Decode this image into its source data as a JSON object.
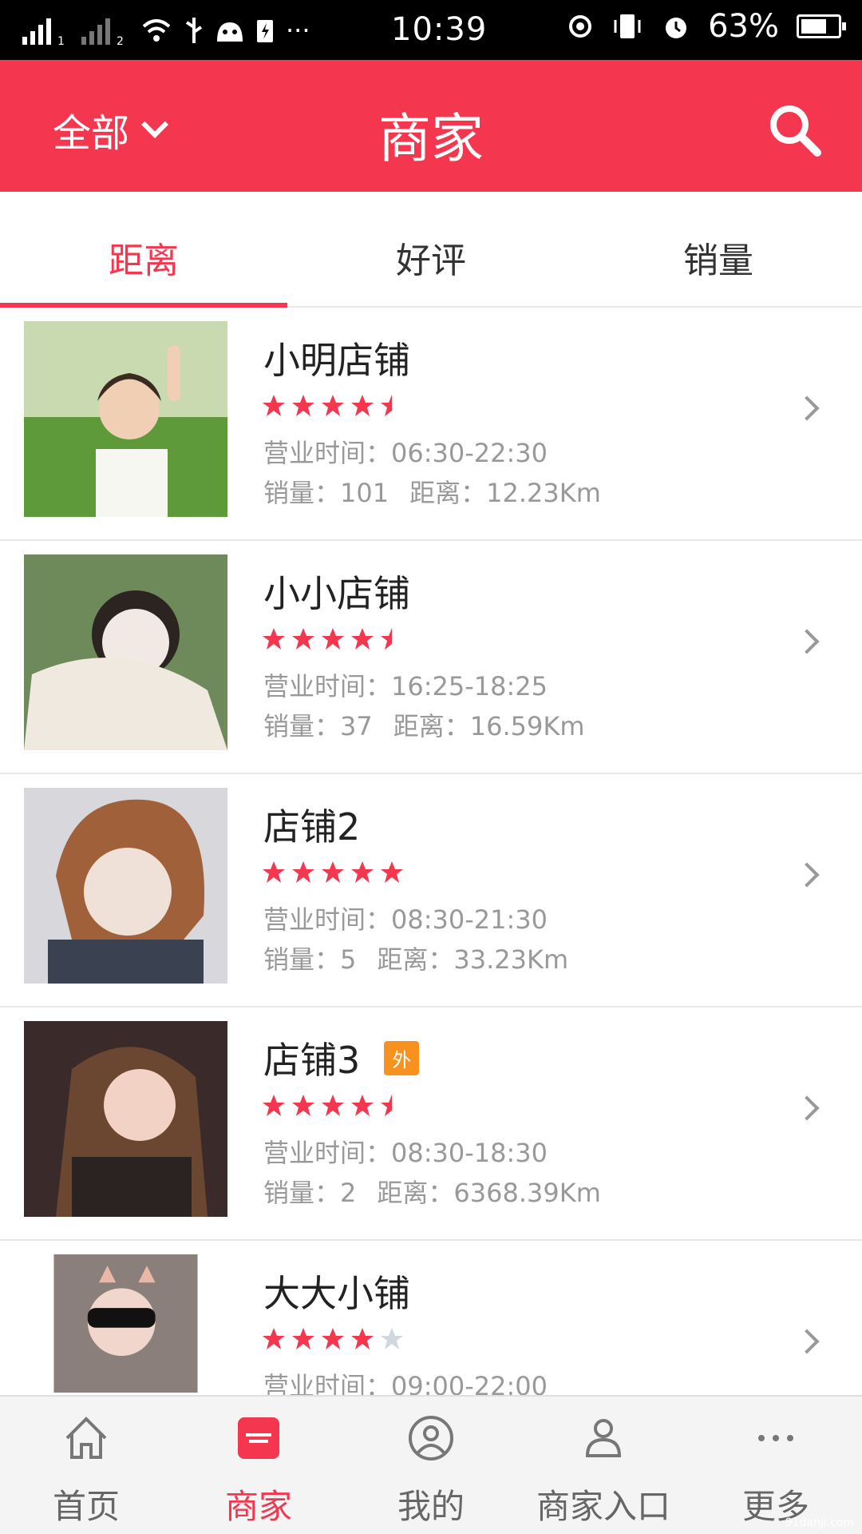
{
  "status_bar": {
    "time": "10:39",
    "battery": "63%",
    "sim1": "1",
    "sim2": "2",
    "more": "···"
  },
  "header": {
    "filter_label": "全部",
    "title": "商家",
    "search_icon": "search-icon",
    "background": "#f5364f"
  },
  "tabs": [
    {
      "label": "距离",
      "active": true
    },
    {
      "label": "好评",
      "active": false
    },
    {
      "label": "销量",
      "active": false
    }
  ],
  "stores": [
    {
      "name": "小明店铺",
      "rating": 4.5,
      "hours_label": "营业时间：",
      "hours": "06:30-22:30",
      "sales_label": "销量：",
      "sales": "101",
      "distance_label": "距离：",
      "distance": "12.23Km"
    },
    {
      "name": "小小店铺",
      "rating": 4.5,
      "hours_label": "营业时间：",
      "hours": "16:25-18:25",
      "sales_label": "销量：",
      "sales": "37",
      "distance_label": "距离：",
      "distance": "16.59Km"
    },
    {
      "name": "店铺2",
      "rating": 5,
      "hours_label": "营业时间：",
      "hours": "08:30-21:30",
      "sales_label": "销量：",
      "sales": "5",
      "distance_label": "距离：",
      "distance": "33.23Km"
    },
    {
      "name": "店铺3",
      "badge": "外",
      "rating": 4.5,
      "hours_label": "营业时间：",
      "hours": "08:30-18:30",
      "sales_label": "销量：",
      "sales": "2",
      "distance_label": "距离：",
      "distance": "6368.39Km"
    },
    {
      "name": "大大小铺",
      "rating": 4,
      "hours_label": "营业时间：",
      "hours": "09:00-22:00"
    }
  ],
  "bottom_nav": [
    {
      "label": "首页",
      "icon": "home-icon",
      "active": false
    },
    {
      "label": "商家",
      "icon": "store-icon",
      "active": true
    },
    {
      "label": "我的",
      "icon": "user-icon",
      "active": false
    },
    {
      "label": "商家入口",
      "icon": "users-icon",
      "active": false
    },
    {
      "label": "更多",
      "icon": "more-icon",
      "active": false
    }
  ],
  "watermark": "91danji.com",
  "colors": {
    "accent": "#f5364f",
    "badge": "#f7921e",
    "star_empty": "#d0d7de"
  }
}
